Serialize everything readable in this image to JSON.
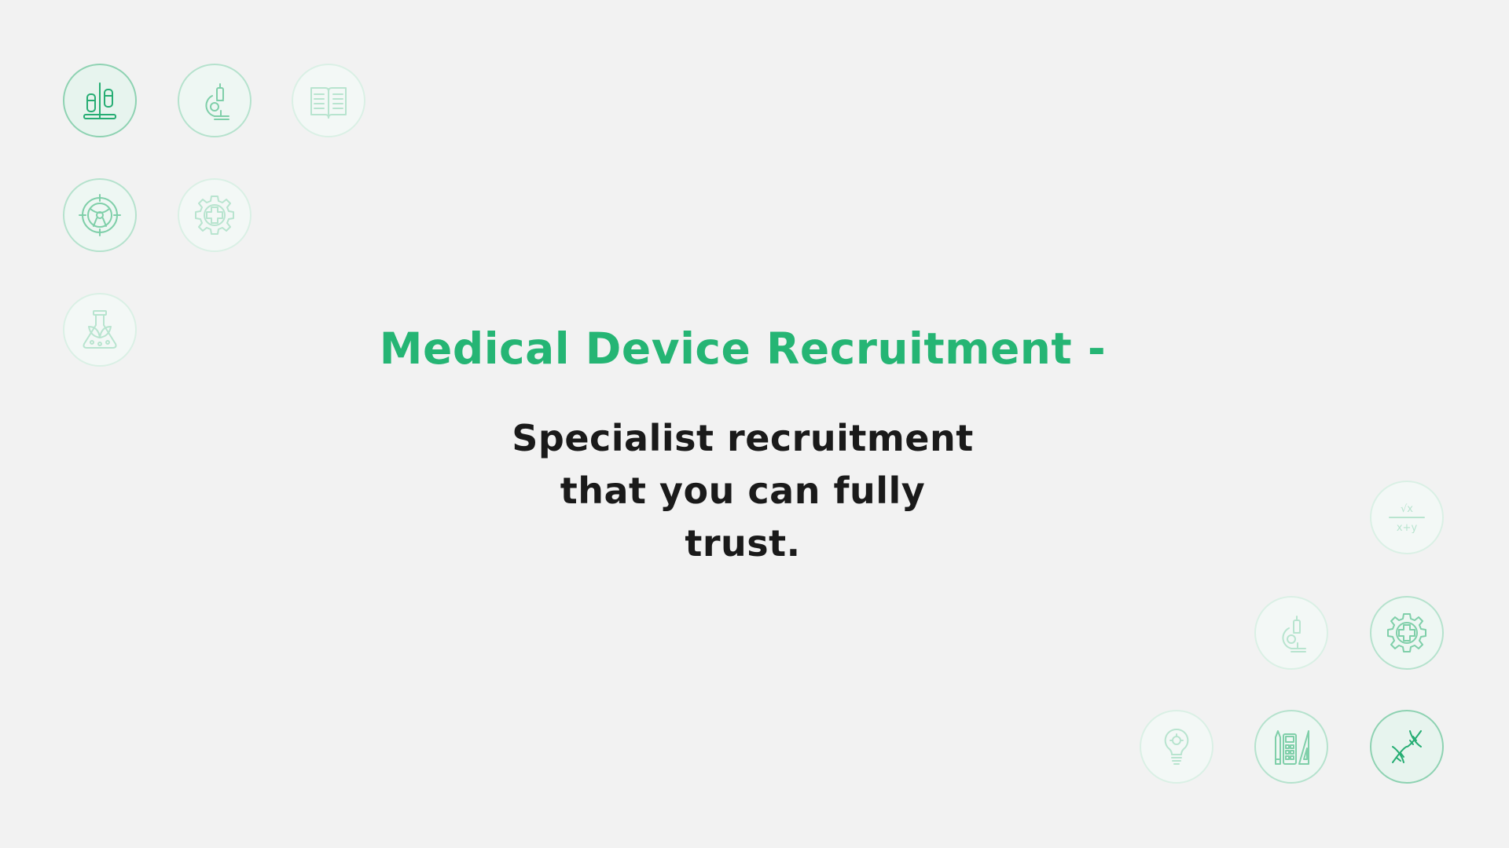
{
  "hero": {
    "headline": "Medical Device Recruitment -",
    "tagline": "Specialist recruitment that you can fully trust.",
    "accent_color": "#25b574",
    "text_color": "#1a1a1a"
  },
  "icon_badges": {
    "top_left": [
      {
        "icon": "test-tubes-icon",
        "shade": "strong"
      },
      {
        "icon": "microscope-icon",
        "shade": "mid"
      },
      {
        "icon": "open-book-icon",
        "shade": "light"
      },
      {
        "icon": "target-icon",
        "shade": "mid"
      },
      {
        "icon": "medical-gear-icon",
        "shade": "light"
      },
      {
        "icon": "plant-flask-icon",
        "shade": "light"
      }
    ],
    "bottom_right": [
      {
        "icon": "math-formula-icon",
        "shade": "light",
        "formula_top": "√x",
        "formula_bottom": "x+y"
      },
      {
        "icon": "microscope-icon",
        "shade": "light"
      },
      {
        "icon": "medical-gear-icon",
        "shade": "mid"
      },
      {
        "icon": "lightbulb-icon",
        "shade": "light"
      },
      {
        "icon": "stationery-icon",
        "shade": "mid"
      },
      {
        "icon": "dna-icon",
        "shade": "strong"
      }
    ]
  }
}
